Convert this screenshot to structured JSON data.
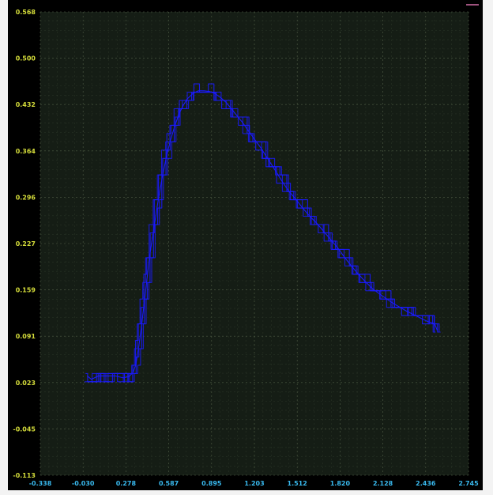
{
  "chart_data": {
    "type": "line",
    "title": "",
    "xlabel": "",
    "ylabel": "",
    "xlim": [
      -0.338,
      2.745
    ],
    "ylim": [
      -0.113,
      0.568
    ],
    "x_ticks": [
      "-0.338",
      "-0.030",
      "0.278",
      "0.587",
      "0.895",
      "1.203",
      "1.512",
      "1.820",
      "2.128",
      "2.436",
      "2.745"
    ],
    "y_ticks": [
      "0.568",
      "0.500",
      "0.432",
      "0.364",
      "0.296",
      "0.227",
      "0.159",
      "0.091",
      "0.023",
      "-0.045",
      "-0.113"
    ],
    "grid": true,
    "legend": "none",
    "colors": {
      "background": "#000000",
      "plot_area": "#151d15",
      "grid": "#4d5a44",
      "trace": "#1a1aff",
      "y_tick_text": "#d4dc3a",
      "x_tick_text": "#39b9ee",
      "corner_accent": "#d46fa8"
    },
    "series": [
      {
        "color": "#1a1aff",
        "x": [
          0.0,
          0.03,
          0.08,
          0.14,
          0.2,
          0.26,
          0.3,
          0.33,
          0.35,
          0.37,
          0.39,
          0.41,
          0.43,
          0.45,
          0.48,
          0.51,
          0.54,
          0.57,
          0.6,
          0.63,
          0.66,
          0.69,
          0.72,
          0.76,
          0.8,
          0.84,
          0.88,
          0.92,
          0.96,
          1.0,
          1.04,
          1.08,
          1.12,
          1.16,
          1.2,
          1.25,
          1.3,
          1.35,
          1.4,
          1.45,
          1.5,
          1.55,
          1.6,
          1.65,
          1.7,
          1.75,
          1.8,
          1.85,
          1.9,
          1.95,
          2.0,
          2.05,
          2.1,
          2.15,
          2.2,
          2.25,
          2.3,
          2.35,
          2.4,
          2.45,
          2.5,
          2.52
        ],
        "y": [
          0.033,
          0.028,
          0.033,
          0.033,
          0.033,
          0.03,
          0.032,
          0.038,
          0.05,
          0.075,
          0.105,
          0.14,
          0.175,
          0.21,
          0.25,
          0.29,
          0.325,
          0.355,
          0.38,
          0.4,
          0.418,
          0.43,
          0.44,
          0.448,
          0.452,
          0.452,
          0.451,
          0.448,
          0.442,
          0.435,
          0.425,
          0.415,
          0.405,
          0.393,
          0.382,
          0.368,
          0.352,
          0.336,
          0.32,
          0.305,
          0.293,
          0.28,
          0.268,
          0.258,
          0.246,
          0.234,
          0.222,
          0.208,
          0.195,
          0.183,
          0.172,
          0.162,
          0.154,
          0.147,
          0.14,
          0.134,
          0.128,
          0.123,
          0.118,
          0.113,
          0.11,
          0.1
        ]
      }
    ]
  }
}
